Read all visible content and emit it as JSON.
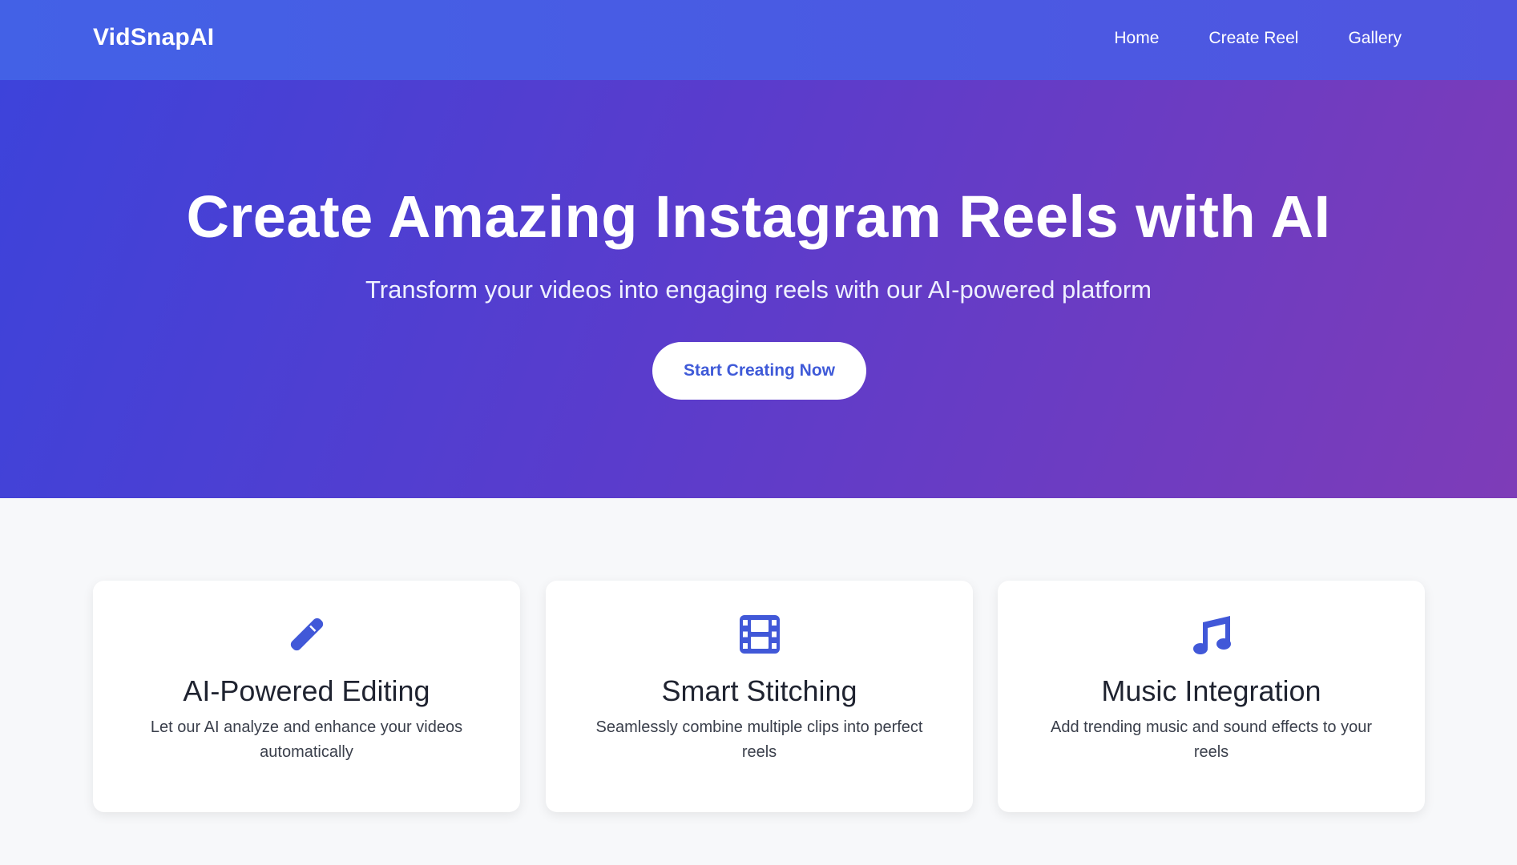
{
  "navbar": {
    "brand": "VidSnapAI",
    "links": [
      "Home",
      "Create Reel",
      "Gallery"
    ]
  },
  "hero": {
    "title": "Create Amazing Instagram Reels with AI",
    "subtitle": "Transform your videos into engaging reels with our AI-powered platform",
    "cta_label": "Start Creating Now"
  },
  "features": [
    {
      "icon": "magic-wand-icon",
      "title": "AI-Powered Editing",
      "description": "Let our AI analyze and enhance your videos automatically"
    },
    {
      "icon": "film-icon",
      "title": "Smart Stitching",
      "description": "Seamlessly combine multiple clips into perfect reels"
    },
    {
      "icon": "music-note-icon",
      "title": "Music Integration",
      "description": "Add trending music and sound effects to your reels"
    }
  ],
  "colors": {
    "accent": "#3f5ad8",
    "nav_bg": "#4361e6",
    "hero_start": "#3d43da",
    "hero_end": "#7e3cb8",
    "page_bg": "#f7f8fa"
  }
}
